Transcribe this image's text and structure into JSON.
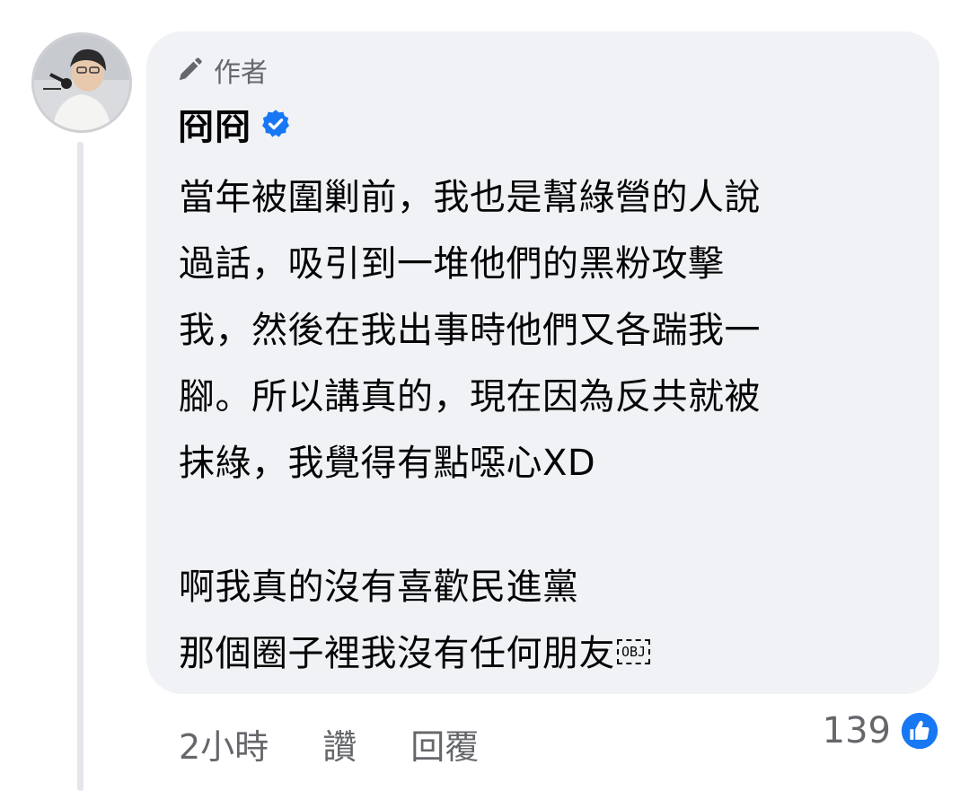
{
  "comment": {
    "author_badge_label": "作者",
    "author_name": "冏冏",
    "body_lines": [
      "當年被圍剿前，我也是幫綠營的人說",
      "過話，吸引到一堆他們的黑粉攻擊",
      "我，然後在我出事時他們又各踹我一",
      "腳。所以講真的，現在因為反共就被",
      "抹綠，我覺得有點噁心XD"
    ],
    "body_lines_2": [
      "啊我真的沒有喜歡民進黨",
      "那個圈子裡我沒有任何朋友"
    ],
    "obj_placeholder": "OBJ",
    "time": "2小時",
    "like_label": "讚",
    "reply_label": "回覆",
    "reaction_count": "139",
    "reaction_icon": "like-icon",
    "accent_color": "#1877f2"
  }
}
